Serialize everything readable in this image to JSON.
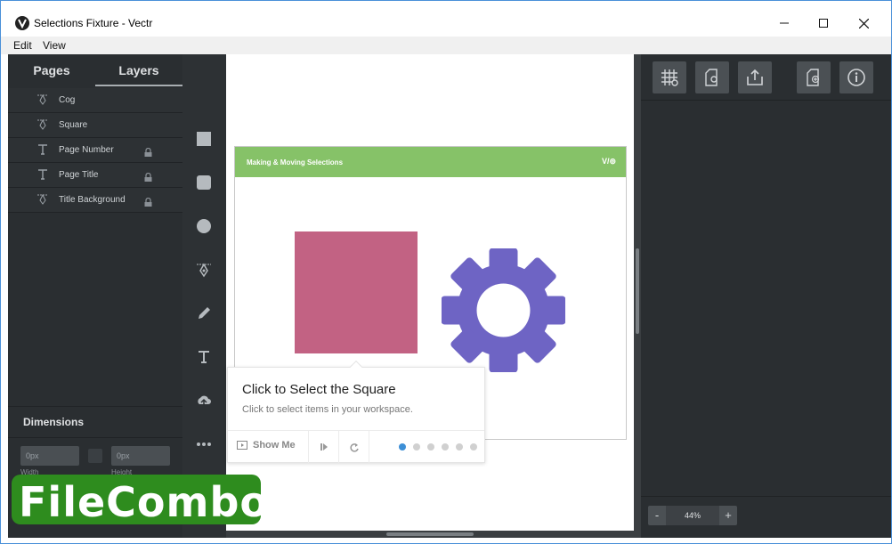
{
  "window": {
    "title": "Selections Fixture - Vectr",
    "minimize": "—",
    "maximize": "☐",
    "close": "✕"
  },
  "menu": {
    "items": [
      "Edit",
      "View"
    ]
  },
  "left_panel": {
    "tabs": [
      "Pages",
      "Layers"
    ],
    "active_tab": "Layers",
    "layers": [
      {
        "label": "Cog",
        "icon": "pen-tool-icon",
        "locked": false
      },
      {
        "label": "Square",
        "icon": "pen-tool-icon",
        "locked": false
      },
      {
        "label": "Page Number",
        "icon": "text-icon",
        "locked": true
      },
      {
        "label": "Page Title",
        "icon": "text-icon",
        "locked": true
      },
      {
        "label": "Title Background",
        "icon": "pen-tool-icon",
        "locked": true
      }
    ],
    "dimensions": {
      "title": "Dimensions",
      "width_value": "0px",
      "height_value": "0px",
      "width_label": "Width",
      "height_label": "Height"
    }
  },
  "toolbar": {
    "tools": [
      "rectangle-tool-icon",
      "rounded-rectangle-tool-icon",
      "ellipse-tool-icon",
      "pen-tool-icon",
      "pencil-tool-icon",
      "text-tool-icon",
      "upload-tool-icon",
      "more-tools-icon"
    ]
  },
  "artboard": {
    "header_title": "Making & Moving Selections",
    "logo": "V/⊚",
    "header_color": "#86c268",
    "square_color": "#c26283",
    "cog_color": "#6e64c4"
  },
  "tutorial": {
    "title": "Click to Select the Square",
    "subtitle": "Click to select items in your workspace.",
    "show_me": "Show Me",
    "steps_total": 6,
    "current_step": 1,
    "dot_active_color": "#3d8fd6"
  },
  "right_panel": {
    "buttons": [
      "grid-settings-icon",
      "page-settings-icon",
      "export-icon",
      "new-page-icon",
      "info-icon"
    ],
    "zoom": {
      "minus": "-",
      "value": "44%",
      "plus": "+"
    }
  },
  "watermark": {
    "text": "FileCombo"
  }
}
